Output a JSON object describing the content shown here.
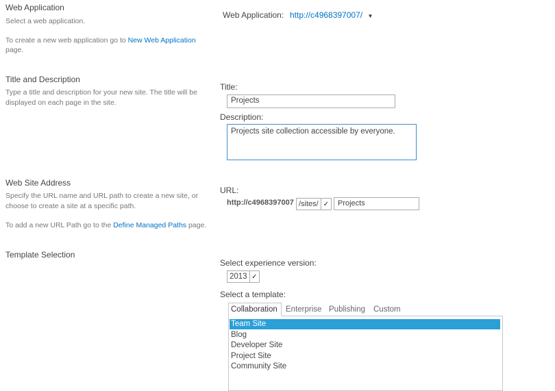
{
  "sections": {
    "web_application": {
      "heading": "Web Application",
      "desc": "Select a web application.",
      "create_prefix": "To create a new web application go to ",
      "create_link": "New Web Application",
      "create_suffix": "page.",
      "field_label": "Web Application:",
      "value": "http://c4968397007/"
    },
    "title_description": {
      "heading": "Title and Description",
      "desc_line1": "Type a title and description for your new site. The title will be",
      "desc_line2": "displayed on each page in the site.",
      "title_label": "Title:",
      "title_value": "Projects",
      "description_label": "Description:",
      "description_value": "Projects site collection accessible by everyone."
    },
    "web_site_address": {
      "heading": "Web Site Address",
      "desc_line1": "Specify the URL name and URL path to create a new site, or",
      "desc_line2": "choose to create a site at a specific path.",
      "managed_prefix": "To add a new URL Path go to the ",
      "managed_link": "Define Managed Paths",
      "managed_suffix": " page.",
      "url_label": "URL:",
      "url_base": "http://c4968397007",
      "path_value": "/sites/",
      "site_name": "Projects"
    },
    "template_selection": {
      "heading": "Template Selection",
      "version_label": "Select experience version:",
      "version_value": "2013",
      "template_label": "Select a template:",
      "tabs": [
        "Collaboration",
        "Enterprise",
        "Publishing",
        "Custom"
      ],
      "active_tab": "Collaboration",
      "templates": [
        "Team Site",
        "Blog",
        "Developer Site",
        "Project Site",
        "Community Site"
      ],
      "selected_template": "Team Site"
    }
  },
  "colors": {
    "link": "#0072c6",
    "selection": "#2a9fd8",
    "focus_border": "#3c8fcf"
  }
}
